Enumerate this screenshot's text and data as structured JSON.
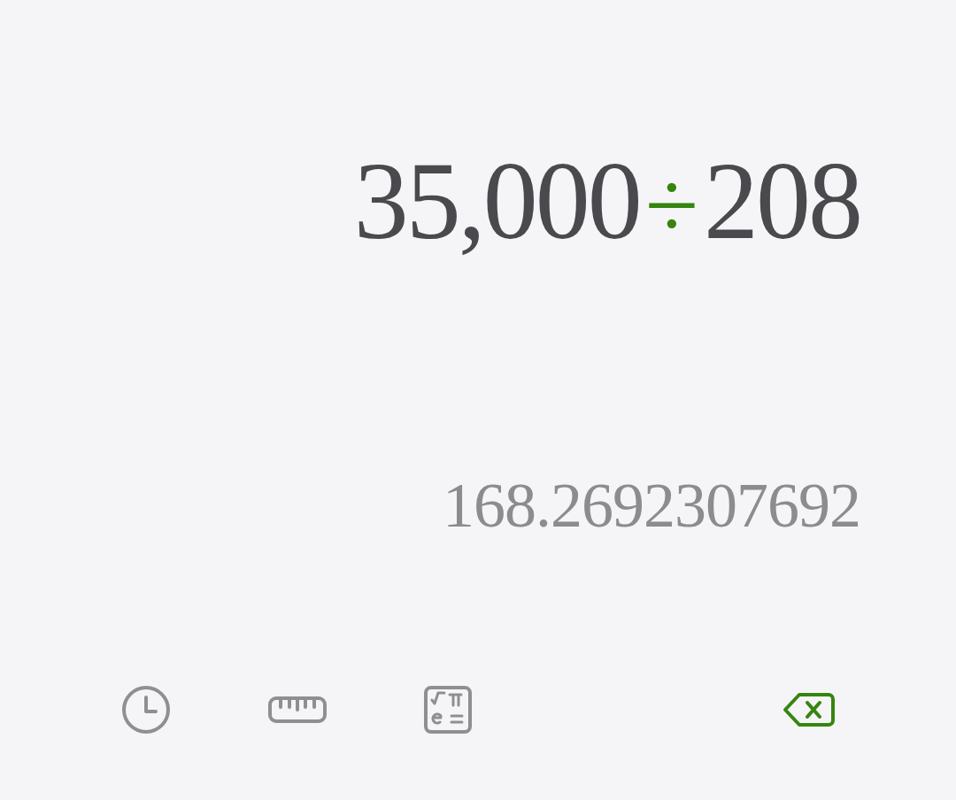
{
  "expression": [
    {
      "kind": "number",
      "text": "35,000"
    },
    {
      "kind": "operator",
      "text": "÷"
    },
    {
      "kind": "number",
      "text": "208"
    }
  ],
  "result": "168.2692307692",
  "toolbar": [
    {
      "kind": "history"
    },
    {
      "kind": "ruler"
    },
    {
      "kind": "scientific"
    },
    {
      "kind": "backspace"
    }
  ]
}
